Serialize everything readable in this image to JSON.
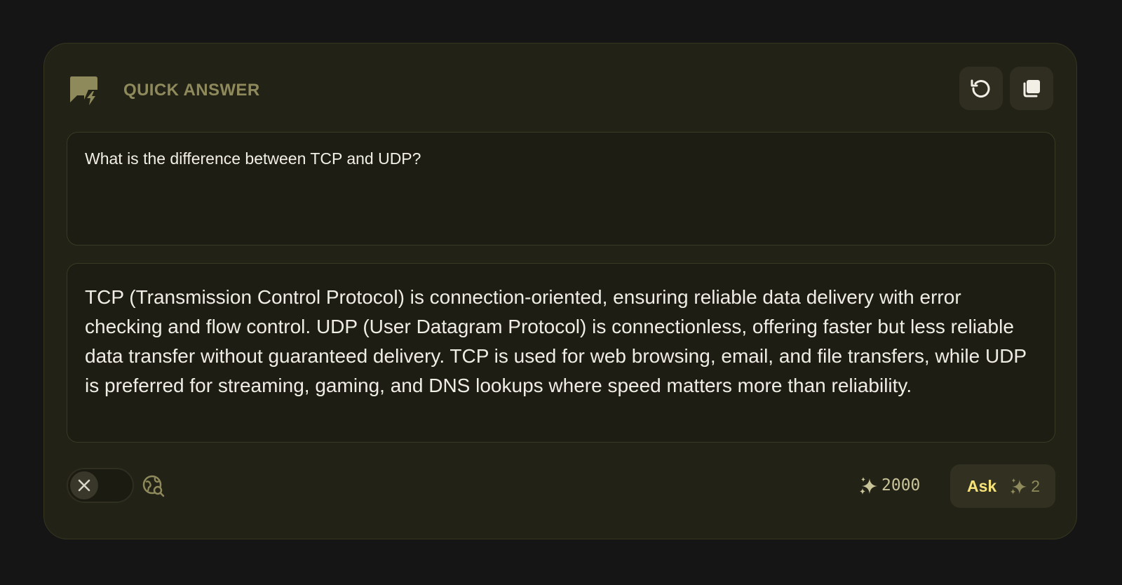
{
  "header": {
    "title": "QUICK ANSWER",
    "logo_icon": "chat-bolt-icon",
    "actions": [
      {
        "name": "reset",
        "icon": "refresh-icon"
      },
      {
        "name": "copy",
        "icon": "copy-icon"
      }
    ]
  },
  "question": {
    "text": "What is the difference between TCP and UDP?"
  },
  "answer": {
    "text": "TCP (Transmission Control Protocol) is connection-oriented, ensuring reliable data delivery with error checking and flow control. UDP (User Datagram Protocol) is connectionless, offering faster but less reliable data transfer without guaranteed delivery. TCP is used for web browsing, email, and file transfers, while UDP is preferred for streaming, gaming, and DNS lookups where speed matters more than reliability."
  },
  "footer": {
    "web_search_toggle": {
      "state": "off",
      "icon": "close-icon"
    },
    "web_search_icon": "globe-search-icon",
    "credits_balance": "2000",
    "ask_label": "Ask",
    "ask_cost": "2"
  },
  "colors": {
    "background": "#151516",
    "card": "#232216",
    "accent": "#f5e27a",
    "muted": "#8e8a5c"
  }
}
